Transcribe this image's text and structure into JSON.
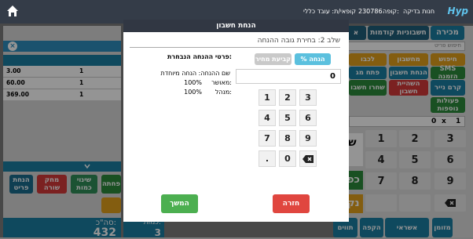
{
  "header": {
    "brand": "Hyp",
    "store": "חנות בדיקה",
    "code_label": "קופה:",
    "code_value": "230786",
    "cashier": "קופאי/ת: עובד כללי"
  },
  "right_tabs": {
    "sale": "מכירה",
    "prev_accounts": "חשבוניות קודמות",
    "third": "א"
  },
  "item_search": "חיפוש פריט",
  "func_buttons": {
    "search": "חיפוש",
    "calculator": "מחשבון",
    "sms": "SMS הזמנה",
    "account_discount": "הנחת חשבון",
    "paper_money": "קרם נייר",
    "cancel_account": "השהיית חשבון",
    "more_actions": "פעולות נוספות",
    "partial1": "לכבו",
    "partial2": "פתח מג",
    "partial3": "שחרו חשבו"
  },
  "qty_field": {
    "qty": "0",
    "x": "x",
    "amount": "1"
  },
  "keypad_bg": [
    "7",
    "8",
    "9",
    "4",
    "5",
    "6",
    "1",
    "2",
    "3"
  ],
  "left_rows": [
    {
      "price": "3.00",
      "qty": "1"
    },
    {
      "price": "60.00",
      "qty": "1"
    },
    {
      "price": "369.00",
      "qty": "1"
    }
  ],
  "left_actions": {
    "item_discount": "הנחת פריט",
    "delete_row": "מחק שורה",
    "change_qty": "שינוי כמות",
    "partial": "פחתה"
  },
  "footer": {
    "total_label": "סה\"כ:",
    "total_value": "432",
    "qty_label": "כמות:",
    "qty_value": "3",
    "pay_buttons": [
      "מזומן",
      "אשראי",
      "הקפה",
      "תווים"
    ],
    "partial_pay": "ש",
    "card": "כפ",
    "cash": "נק"
  },
  "modal": {
    "title": "הנחת חשבון",
    "step": "שלב 2: בחירת גובה ההנחה",
    "details_title": "פרטי ההנחה הנבחרת:",
    "tab_percent": "% הנחה",
    "tab_fixed": "קביעת מחיר",
    "input_value": "0",
    "detail_name_label": "שם ההנחה: הנחה מיוחדת",
    "detail_approved_label": "מאושר:",
    "detail_approved_value": "100%",
    "detail_manager_label": "מנהל:",
    "detail_manager_value": "100%",
    "keys": [
      "1",
      "2",
      "3",
      "4",
      "5",
      "6",
      "7",
      "8",
      "9",
      ".",
      "0"
    ],
    "continue": "המשך",
    "back": "חזרה"
  },
  "colors": {
    "header_bg": "#343c48",
    "tab_blue": "#1a7ea3",
    "orange": "#e2a11c",
    "green": "#4caf50",
    "red": "#e0463f",
    "teal": "#2d8a7e",
    "light_blue": "#5bc0de",
    "brand": "#5fc3ec"
  },
  "icons": {
    "home": "home-icon",
    "close": "close-icon",
    "backspace": "backspace-icon",
    "chevron": "chevron-down-icon"
  }
}
